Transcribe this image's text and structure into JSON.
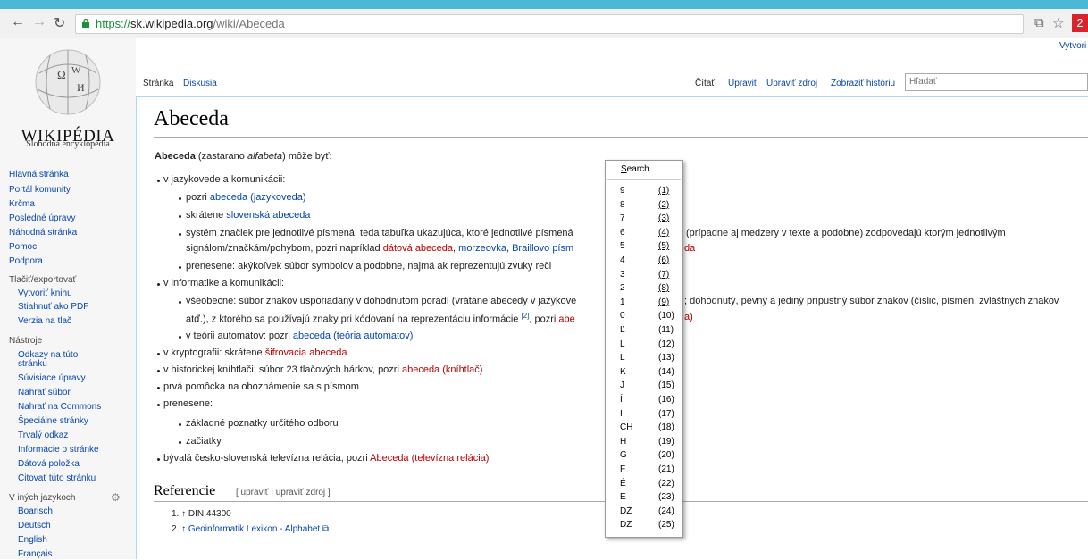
{
  "browser": {
    "url_scheme": "https://",
    "url_host": "sk.wikipedia.org",
    "url_path": "/wiki/Abeceda",
    "ext_label": "2"
  },
  "logo": {
    "wordmark": "WIKIPÉDIA",
    "tagline": "Slobodná encyklopédia"
  },
  "sidebar": {
    "nav": [
      "Hlavná stránka",
      "Portál komunity",
      "Krčma",
      "Posledné úpravy",
      "Náhodná stránka",
      "Pomoc",
      "Podpora"
    ],
    "print_heading": "Tlačiť/exportovať",
    "print": [
      "Vytvoriť knihu",
      "Stiahnuť ako PDF",
      "Verzia na tlač"
    ],
    "tools_heading": "Nástroje",
    "tools": [
      "Odkazy na túto",
      "stránku",
      "Súvisiace úpravy",
      "Nahrať súbor",
      "Nahrať na Commons",
      "Špeciálne stránky",
      "Trvalý odkaz",
      "Informácie o stránke",
      "Dátová položka",
      "Citovať túto stránku"
    ],
    "lang_heading": "V iných jazykoch",
    "langs": [
      "Boarisch",
      "Deutsch",
      "English",
      "Français"
    ]
  },
  "tabs": {
    "page": "Stránka",
    "talk": "Diskusia",
    "read": "Čítať",
    "edit": "Upraviť",
    "edit_source": "Upraviť zdroj",
    "history": "Zobraziť históriu",
    "search_placeholder": "Hľadať",
    "create_account": "Vytvori"
  },
  "article": {
    "title": "Abeceda",
    "intro_bold": "Abeceda",
    "intro_a": " (zastarano ",
    "intro_i": "alfabeta",
    "intro_b": ") môže byť:",
    "b1": "v jazykovede a komunikácii:",
    "b1a_pre": "pozri ",
    "b1a_link": "abeceda (jazykoveda)",
    "b1b_pre": "skrátene ",
    "b1b_link": "slovenská abeceda",
    "b1c_l1_a": "systém značiek pre jednotlivé písmená, teda tabuľka ukazujúca, ktoré jednotlivé písmená",
    "b1c_l1_b": "(prípadne aj medzery v texte a podobne) zodpovedajú ktorým jednotlivým",
    "b1c_l2_pre": "signálom/značkám/pohybom, pozri napríklad ",
    "b1c_l2_link1": "dátová abeceda",
    "b1c_l2_sep1": ", ",
    "b1c_l2_link2": "morzeovka",
    "b1c_l2_sep2": ", ",
    "b1c_l2_link3": "Braillovo písm",
    "b1c_l2_tail": "da",
    "b1d": "prenesene: akýkoľvek súbor symbolov a podobne, najmä ak reprezentujú zvuky reči",
    "b2": "v informatike a komunikácii:",
    "b2a_l1_a": "všeobecne: súbor znakov usporiadaný v dohodnutom poradí (vrátane abecedy v jazykove",
    "b2a_l1_b": "; dohodnutý, pevný a jediný prípustný súbor znakov (číslic, písmen, zvláštnych znakov",
    "b2a_l2_a": "atď.), z ktorého sa používajú znaky pri kódovaní na reprezentáciu informácie ",
    "b2a_l2_ref": "[2]",
    "b2a_l2_b": ", pozri ",
    "b2a_l2_link": "abe",
    "b2a_l2_tail": "a)",
    "b2b_pre": "v teórii automatov: pozri ",
    "b2b_link": "abeceda (teória automatov)",
    "b3_pre": "v kryptografii: skrátene ",
    "b3_link": "šifrovacia abeceda",
    "b4_pre": "v historickej kníhtlači: súbor 23 tlačových hárkov, pozri ",
    "b4_link": "abeceda (kníhtlač)",
    "b5": "prvá pomôcka na oboznámenie sa s písmom",
    "b6": "prenesene:",
    "b6a": "základné poznatky určitého odboru",
    "b6b": "začiatky",
    "b7_pre": "bývalá česko-slovenská televízna relácia, pozri ",
    "b7_link": "Abeceda (televízna relácia)",
    "refs_title": "Referencie",
    "refs_edit": "[ upraviť | upraviť zdroj ]",
    "ref1": "1. ↑ DIN 44300",
    "ref2_pre": "2. ↑ ",
    "ref2_link": "Geoinformatik Lexikon - Alphabet"
  },
  "context_menu": {
    "title": "Search",
    "items": [
      {
        "key": "9",
        "num": "(1)"
      },
      {
        "key": "8",
        "num": "(2)"
      },
      {
        "key": "7",
        "num": "(3)"
      },
      {
        "key": "6",
        "num": "(4)"
      },
      {
        "key": "5",
        "num": "(5)"
      },
      {
        "key": "4",
        "num": "(6)"
      },
      {
        "key": "3",
        "num": "(7)"
      },
      {
        "key": "2",
        "num": "(8)"
      },
      {
        "key": "1",
        "num": "(9)"
      },
      {
        "key": "0",
        "num": "(10)"
      },
      {
        "key": "Ľ",
        "num": "(11)"
      },
      {
        "key": "Ĺ",
        "num": "(12)"
      },
      {
        "key": "L",
        "num": "(13)"
      },
      {
        "key": "K",
        "num": "(14)"
      },
      {
        "key": "J",
        "num": "(15)"
      },
      {
        "key": "Í",
        "num": "(16)"
      },
      {
        "key": "I",
        "num": "(17)"
      },
      {
        "key": "CH",
        "num": "(18)"
      },
      {
        "key": "H",
        "num": "(19)"
      },
      {
        "key": "G",
        "num": "(20)"
      },
      {
        "key": "F",
        "num": "(21)"
      },
      {
        "key": "É",
        "num": "(22)"
      },
      {
        "key": "E",
        "num": "(23)"
      },
      {
        "key": "DŽ",
        "num": "(24)"
      },
      {
        "key": "DZ",
        "num": "(25)"
      }
    ]
  },
  "colors": {
    "link": "#0645ad",
    "redlink": "#ba0000",
    "frame": "#4bb8d8"
  },
  "icons": {
    "back": "arrow-left-icon",
    "forward": "arrow-right-icon",
    "reload": "reload-icon",
    "lock": "lock-icon",
    "star": "star-icon",
    "translate": "translate-icon",
    "gear": "gear-icon"
  }
}
